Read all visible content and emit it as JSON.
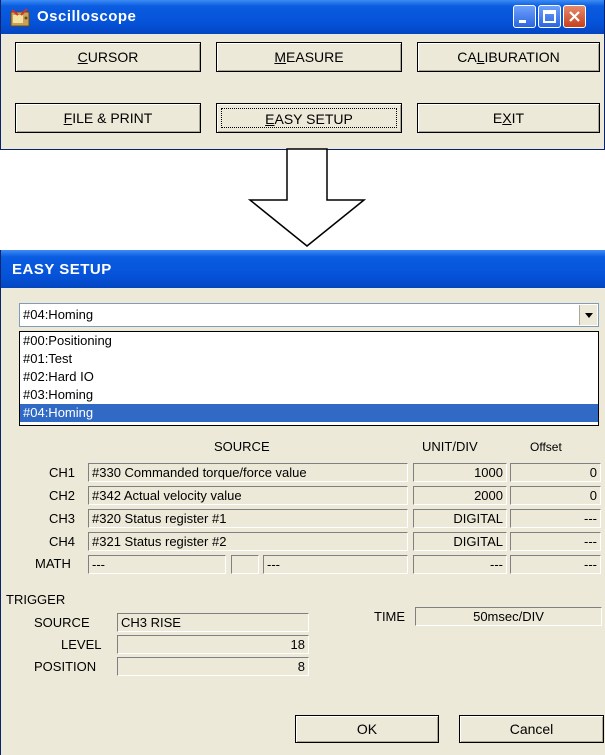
{
  "osc_window": {
    "title": "Oscilloscope",
    "buttons": {
      "cursor": {
        "prefix": "",
        "mnemonic": "C",
        "rest": "URSOR"
      },
      "measure": {
        "prefix": "",
        "mnemonic": "M",
        "rest": "EASURE"
      },
      "calibration": {
        "prefix": "CA",
        "mnemonic": "L",
        "rest": "IBURATION"
      },
      "file_print": {
        "prefix": "",
        "mnemonic": "F",
        "rest": "ILE & PRINT"
      },
      "easy_setup": {
        "prefix": "",
        "mnemonic": "E",
        "rest": "ASY SETUP"
      },
      "exit": {
        "prefix": "E",
        "mnemonic": "X",
        "rest": "IT"
      }
    }
  },
  "easy_setup": {
    "title": "EASY SETUP",
    "combo_value": "#04:Homing",
    "dropdown_items": [
      "#00:Positioning",
      "#01:Test",
      "#02:Hard IO",
      "#03:Homing",
      "#04:Homing"
    ],
    "headers": {
      "source": "SOURCE",
      "unit_div": "UNIT/DIV",
      "offset": "Offset"
    },
    "channels": [
      {
        "label": "CH1",
        "source": "#330  Commanded torque/force value",
        "unit": "1000",
        "offset": "0"
      },
      {
        "label": "CH2",
        "source": "#342  Actual velocity value",
        "unit": "2000",
        "offset": "0"
      },
      {
        "label": "CH3",
        "source": "#320  Status register #1",
        "unit": "DIGITAL",
        "offset": "---"
      },
      {
        "label": "CH4",
        "source": "#321  Status register #2",
        "unit": "DIGITAL",
        "offset": "---"
      }
    ],
    "math": {
      "label": "MATH",
      "src1": "---",
      "op": "",
      "src2": "---",
      "unit": "---",
      "offset": "---"
    },
    "trigger": {
      "heading": "TRIGGER",
      "source_label": "SOURCE",
      "source_value": "CH3 RISE",
      "level_label": "LEVEL",
      "level_value": "18",
      "position_label": "POSITION",
      "position_value": "8"
    },
    "time": {
      "label": "TIME",
      "value": "50msec/DIV"
    },
    "ok_label": "OK",
    "cancel_label": "Cancel"
  }
}
